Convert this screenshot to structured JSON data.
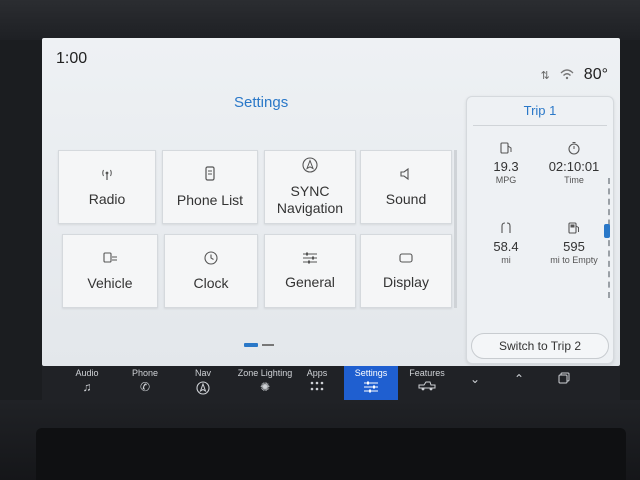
{
  "status": {
    "time": "1:00",
    "temperature": "80°",
    "icons": [
      "data-transfer-icon",
      "wifi-icon"
    ]
  },
  "page_title": "Settings",
  "tiles": [
    {
      "label": "Radio",
      "icon": "radio-antenna-icon"
    },
    {
      "label": "Phone List",
      "icon": "phone-list-icon"
    },
    {
      "label": "SYNC Navigation",
      "icon": "navigation-icon"
    },
    {
      "label": "Sound",
      "icon": "speaker-icon"
    },
    {
      "label": "Vehicle",
      "icon": "vehicle-settings-icon"
    },
    {
      "label": "Clock",
      "icon": "clock-icon"
    },
    {
      "label": "General",
      "icon": "sliders-icon"
    },
    {
      "label": "Display",
      "icon": "display-icon"
    }
  ],
  "pagination": {
    "pages": 2,
    "current": 1
  },
  "trip": {
    "title": "Trip 1",
    "stats": [
      {
        "value": "19.3",
        "unit": "MPG",
        "icon": "fuel-economy-icon"
      },
      {
        "value": "02:10:01",
        "unit": "Time",
        "icon": "stopwatch-icon"
      },
      {
        "value": "58.4",
        "unit": "mi",
        "icon": "distance-icon"
      },
      {
        "value": "595",
        "unit": "mi to Empty",
        "icon": "fuel-pump-icon"
      }
    ],
    "switch_label": "Switch to Trip 2"
  },
  "navbar": {
    "items": [
      {
        "label": "Audio",
        "icon": "music-note-icon"
      },
      {
        "label": "Phone",
        "icon": "phone-icon"
      },
      {
        "label": "Nav",
        "icon": "navigation-icon"
      },
      {
        "label": "Zone Lighting",
        "icon": "zone-lighting-icon"
      },
      {
        "label": "Apps",
        "icon": "apps-grid-icon"
      },
      {
        "label": "Settings",
        "icon": "settings-sliders-icon"
      },
      {
        "label": "Features",
        "icon": "truck-icon"
      }
    ],
    "active": "Settings",
    "extra_icons": [
      "chevron-down-icon",
      "chevron-up-icon",
      "copy-screens-icon"
    ]
  },
  "colors": {
    "accent": "#2a78c8",
    "nav_active": "#1f5fd0",
    "nav_bg": "#202226",
    "screen_bg": "#e9ecef"
  }
}
